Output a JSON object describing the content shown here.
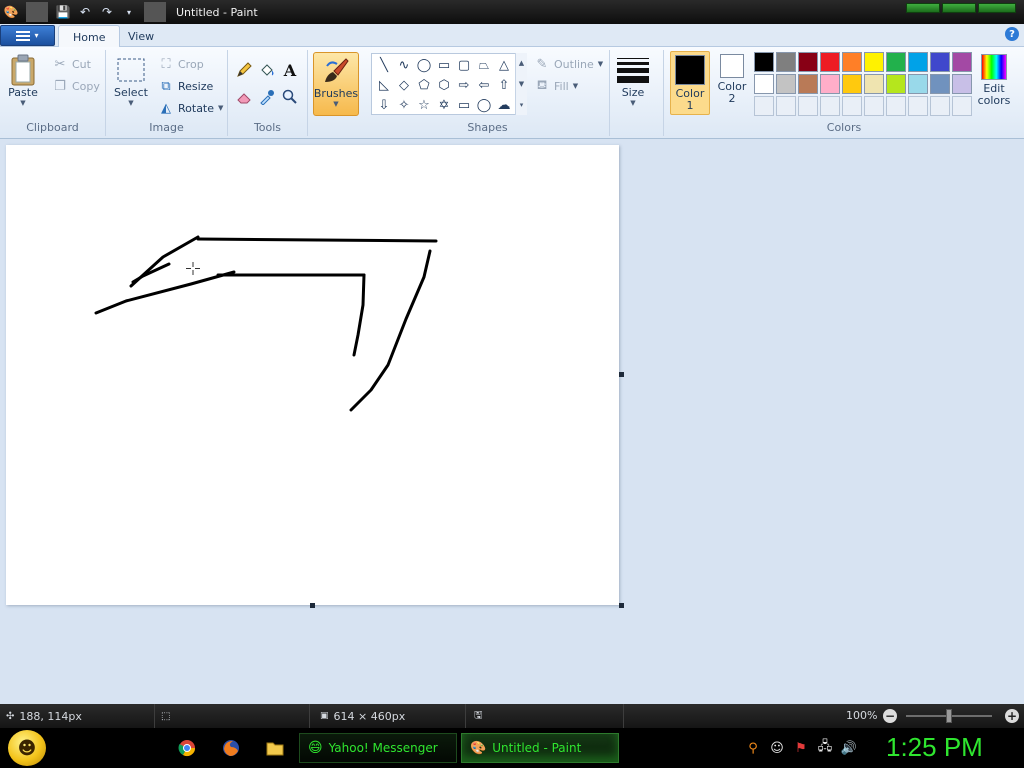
{
  "titlebar": {
    "title": "Untitled - Paint",
    "quick_access": [
      "save-icon",
      "undo-icon",
      "redo-icon",
      "customize-dropdown-icon"
    ]
  },
  "tabs": [
    {
      "label": "Home",
      "active": true
    },
    {
      "label": "View",
      "active": false
    }
  ],
  "ribbon": {
    "clipboard": {
      "label": "Clipboard",
      "paste": "Paste",
      "cut": "Cut",
      "copy": "Copy"
    },
    "image": {
      "label": "Image",
      "select": "Select",
      "crop": "Crop",
      "resize": "Resize",
      "rotate": "Rotate"
    },
    "tools": {
      "label": "Tools",
      "items": [
        "pencil-icon",
        "fill-icon",
        "text-icon",
        "eraser-icon",
        "color-picker-icon",
        "magnifier-icon"
      ],
      "text_glyph": "A"
    },
    "brushes": {
      "label": "Brushes"
    },
    "shapes": {
      "label": "Shapes",
      "outline": "Outline",
      "fill": "Fill",
      "items": [
        "line",
        "curve",
        "oval",
        "rectangle",
        "rounded-rectangle",
        "polygon",
        "triangle",
        "right-triangle",
        "diamond",
        "pentagon",
        "hexagon",
        "right-arrow",
        "left-arrow",
        "up-arrow",
        "down-arrow",
        "four-point-star",
        "five-point-star",
        "six-point-star",
        "rounded-callout",
        "oval-callout",
        "cloud-callout"
      ]
    },
    "size": {
      "label": "Size"
    },
    "colors": {
      "label": "Colors",
      "color1_label": "Color",
      "color1_num": "1",
      "color2_label": "Color",
      "color2_num": "2",
      "color1": "#000000",
      "color2": "#ffffff",
      "edit_label": "Edit",
      "edit_label2": "colors",
      "palette": [
        "#000000",
        "#7f7f7f",
        "#880015",
        "#ed1c24",
        "#ff7f27",
        "#fff200",
        "#22b14c",
        "#00a2e8",
        "#3f48cc",
        "#a349a4",
        "#ffffff",
        "#c3c3c3",
        "#b97a57",
        "#ffaec9",
        "#ffc90e",
        "#efe4b0",
        "#b5e61d",
        "#99d9ea",
        "#7092be",
        "#c8bfe7",
        "",
        "",
        "",
        "",
        "",
        "",
        "",
        "",
        "",
        ""
      ]
    }
  },
  "statusbar": {
    "cursor_pos": "188, 114px",
    "canvas_size": "614 × 460px",
    "zoom": "100%",
    "zoom_fraction": 0.5
  },
  "taskbar": {
    "quick_launch": [
      "chrome-icon",
      "firefox-icon",
      "folder-icon"
    ],
    "buttons": [
      {
        "label": "Yahoo! Messenger",
        "icon": "messenger-icon",
        "active": false
      },
      {
        "label": "Untitled - Paint",
        "icon": "paint-icon",
        "active": true
      }
    ],
    "tray": [
      "search-icon",
      "smiley-icon",
      "flag-icon",
      "network-icon",
      "volume-icon"
    ],
    "clock": "1:25 PM"
  }
}
